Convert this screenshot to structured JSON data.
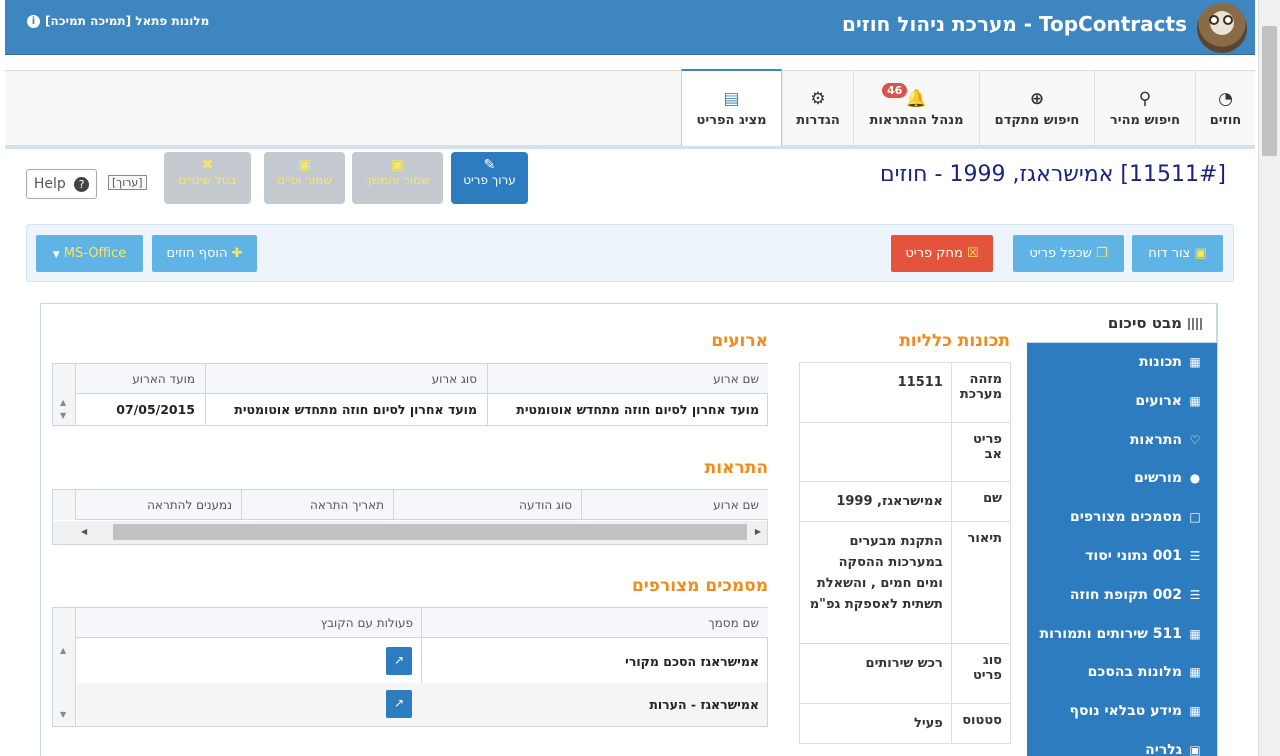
{
  "header": {
    "title": "TopContracts - מערכת ניהול חוזים",
    "support_label": "מלונות פתאל [תמיכה תמיכה]"
  },
  "nav": {
    "tabs": [
      {
        "label": "חוזים",
        "icon": "dashboard-icon"
      },
      {
        "label": "חיפוש מהיר",
        "icon": "search-icon"
      },
      {
        "label": "חיפוש מתקדם",
        "icon": "zoom-in-icon"
      },
      {
        "label": "מנהל ההתראות",
        "icon": "bell-icon",
        "badge": "46"
      },
      {
        "label": "הגדרות",
        "icon": "gear-icon"
      },
      {
        "label": "מציג הפריט",
        "icon": "book-icon",
        "active": true
      }
    ]
  },
  "record": {
    "title": "[11511#] אמישראגז, 1999 - חוזים",
    "buttons": {
      "edit": "ערוך פריט",
      "save_continue": "שמור והמשך",
      "save_close": "שמור וסיים",
      "cancel": "בטל שינויים"
    },
    "edit_tag": "[ערוך]",
    "help": "Help"
  },
  "toolbar": {
    "report": "צור דוח",
    "duplicate": "שכפל פריט",
    "delete": "מחק פריט",
    "add_contracts": "הוסף חוזים",
    "ms_office": "MS-Office"
  },
  "side_menu": {
    "header": "מבט סיכום",
    "items": [
      {
        "label": "תכונות",
        "icon": "grid-icon"
      },
      {
        "label": "ארועים",
        "icon": "calendar-icon"
      },
      {
        "label": "התראות",
        "icon": "bell-icon"
      },
      {
        "label": "מורשים",
        "icon": "users-icon"
      },
      {
        "label": "מסמכים מצורפים",
        "icon": "file-icon"
      },
      {
        "label": "001 נתוני יסוד",
        "icon": "list-icon"
      },
      {
        "label": "002 תקופת חוזה",
        "icon": "list-icon"
      },
      {
        "label": "511 שירותים ותמורות",
        "icon": "table-icon"
      },
      {
        "label": "מלונות בהסכם",
        "icon": "table-icon"
      },
      {
        "label": "מידע טבלאי נוסף",
        "icon": "table-icon"
      },
      {
        "label": "גלריה",
        "icon": "image-icon"
      }
    ]
  },
  "general": {
    "title": "תכונות כלליות",
    "rows": [
      {
        "key": "מזהה מערכת",
        "value": "11511"
      },
      {
        "key": "פריט אב",
        "value": ""
      },
      {
        "key": "שם",
        "value": "אמישראגז, 1999"
      },
      {
        "key": "תיאור",
        "value": "התקנת מבערים במערכות ההסקה ומים חמים , והשאלת תשתית לאספקת גפ\"מ"
      },
      {
        "key": "סוג פריט",
        "value": "רכש שירותים"
      },
      {
        "key": "סטטוס",
        "value": "פעיל"
      }
    ]
  },
  "events": {
    "title": "ארועים",
    "columns": [
      "שם ארוע",
      "סוג ארוע",
      "מועד הארוע"
    ],
    "rows": [
      [
        "מועד אחרון לסיום חוזה מתחדש אוטומטית",
        "מועד אחרון לסיום חוזה מתחדש אוטומטית",
        "07/05/2015"
      ]
    ]
  },
  "alerts": {
    "title": "התראות",
    "columns": [
      "שם ארוע",
      "סוג הודעה",
      "תאריך התראה",
      "נמענים להתראה"
    ]
  },
  "attachments": {
    "title": "מסמכים מצורפים",
    "columns": [
      "שם מסמך",
      "פעולות עם הקובץ"
    ],
    "rows": [
      {
        "name": "אמישראגז הסכם מקורי"
      },
      {
        "name": "אמישראגז - הערות"
      }
    ]
  }
}
